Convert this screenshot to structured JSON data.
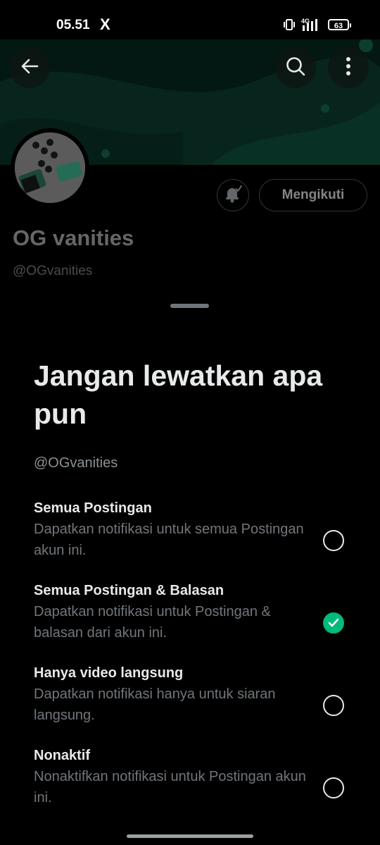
{
  "status_bar": {
    "time": "05.51",
    "app_glyph": "X",
    "network": "4G",
    "battery": "63",
    "icons": [
      "vibrate-icon",
      "signal-icon",
      "battery-icon"
    ]
  },
  "header": {
    "icons": [
      "back-arrow-icon",
      "search-icon",
      "more-vertical-icon"
    ]
  },
  "profile": {
    "name": "OG vanities",
    "handle": "@OGvanities",
    "follow_label": "Mengikuti",
    "bell_icon": "bell-check-icon"
  },
  "sheet": {
    "title": "Jangan lewatkan apa pun",
    "handle": "@OGvanities",
    "options": [
      {
        "title": "Semua Postingan",
        "desc": "Dapatkan notifikasi untuk semua Postingan akun ini.",
        "selected": false
      },
      {
        "title": "Semua Postingan & Balasan",
        "desc": "Dapatkan notifikasi untuk Postingan & balasan dari akun ini.",
        "selected": true
      },
      {
        "title": "Hanya video langsung",
        "desc": "Dapatkan notifikasi hanya untuk siaran langsung.",
        "selected": false
      },
      {
        "title": "Nonaktif",
        "desc": "Nonaktifkan notifikasi untuk Postingan akun ini.",
        "selected": false
      }
    ]
  },
  "colors": {
    "background": "#000000",
    "accent_green": "#00ba7c",
    "text_primary": "#e7e9ea",
    "text_secondary": "#71767b",
    "banner": "#06251d"
  }
}
